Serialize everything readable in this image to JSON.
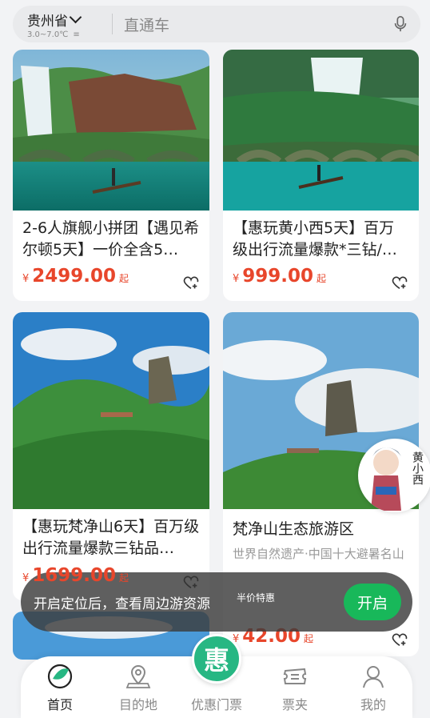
{
  "search": {
    "province": "贵州省",
    "temp_range": "3.0~7.0℃",
    "weather_symbol": "≡",
    "placeholder": "直通车"
  },
  "products": [
    {
      "title": "2-6人旗舰小拼团【遇见希尔顿5天】一价全含5…",
      "currency": "¥",
      "price": "2499.00",
      "suffix": "起"
    },
    {
      "title": "【惠玩黄小西5天】百万级出行流量爆款*三钻/…",
      "currency": "¥",
      "price": "999.00",
      "suffix": "起"
    },
    {
      "title": "【惠玩梵净山6天】百万级出行流量爆款三钻品…",
      "currency": "¥",
      "price": "1699.00",
      "suffix": "起"
    },
    {
      "title": "梵净山生态旅游区",
      "subtitle": "世界自然遗产·中国十大避暑名山",
      "badge": "半价特惠",
      "currency": "¥",
      "price": "42.00",
      "suffix": "起"
    }
  ],
  "mascot": {
    "text": "黄小西"
  },
  "toast": {
    "message": "开启定位后，查看周边游资源",
    "button": "开启"
  },
  "nav": {
    "center_label": "惠",
    "items": [
      {
        "label": "首页",
        "icon": "home-icon",
        "active": true
      },
      {
        "label": "目的地",
        "icon": "map-pin-icon"
      },
      {
        "label": "优惠门票",
        "icon": "hui-icon"
      },
      {
        "label": "票夹",
        "icon": "ticket-icon"
      },
      {
        "label": "我的",
        "icon": "user-icon"
      }
    ]
  },
  "colors": {
    "accent": "#18b85a",
    "price": "#e8462b",
    "nav_center": "#27b783"
  }
}
